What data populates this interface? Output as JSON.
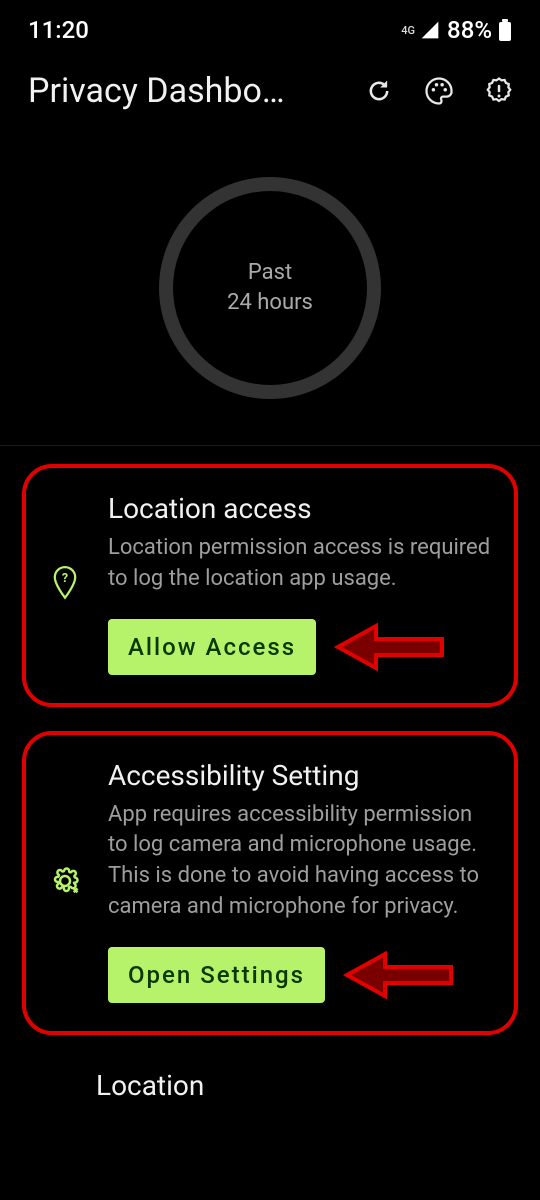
{
  "statusbar": {
    "time": "11:20",
    "network": "4G",
    "battery": "88%"
  },
  "titlebar": {
    "title": "Privacy Dashbo…"
  },
  "chart": {
    "line1": "Past",
    "line2": "24 hours"
  },
  "cards": [
    {
      "title": "Location access",
      "desc": "Location permission access is required to log the location app usage.",
      "button": "Allow Access"
    },
    {
      "title": "Accessibility Setting",
      "desc": "App requires accessibility permission to log camera and microphone usage. This is done to avoid having access to camera and microphone for privacy.",
      "button": "Open Settings"
    }
  ],
  "section": {
    "heading": "Location"
  },
  "colors": {
    "accent": "#b6f36b",
    "annotation": "#e10000"
  }
}
